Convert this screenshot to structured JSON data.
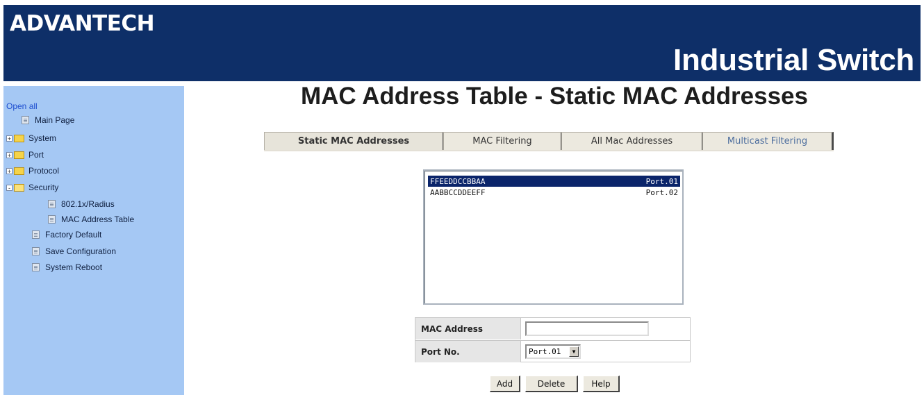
{
  "header": {
    "logo": "ADVANTECH",
    "product": "Industrial Switch"
  },
  "sidebar": {
    "open_all": "Open all",
    "items": [
      {
        "label": "Main Page",
        "type": "page"
      },
      {
        "label": "System",
        "type": "folder",
        "expand": "+"
      },
      {
        "label": "Port",
        "type": "folder",
        "expand": "+"
      },
      {
        "label": "Protocol",
        "type": "folder",
        "expand": "+"
      },
      {
        "label": "Security",
        "type": "folder",
        "expand": "-"
      },
      {
        "label": "802.1x/Radius",
        "type": "page"
      },
      {
        "label": "MAC Address Table",
        "type": "page"
      },
      {
        "label": "Factory Default",
        "type": "page"
      },
      {
        "label": "Save Configuration",
        "type": "page"
      },
      {
        "label": "System Reboot",
        "type": "page"
      }
    ]
  },
  "main": {
    "title": "MAC Address Table - Static MAC Addresses",
    "tabs": [
      {
        "label": "Static MAC Addresses",
        "active": true
      },
      {
        "label": "MAC Filtering",
        "active": false
      },
      {
        "label": "All Mac Addresses",
        "active": false
      },
      {
        "label": "Multicast Filtering",
        "active": false
      }
    ],
    "list": [
      {
        "mac": "FFEEDDCCBBAA",
        "port": "Port.01",
        "selected": true
      },
      {
        "mac": "AABBCCDDEEFF",
        "port": "Port.02",
        "selected": false
      }
    ],
    "form": {
      "mac_label": "MAC Address",
      "mac_value": "",
      "port_label": "Port No.",
      "port_value": "Port.01"
    },
    "buttons": {
      "add": "Add",
      "delete": "Delete",
      "help": "Help"
    }
  },
  "colors": {
    "header_bg": "#0e2f68",
    "sidebar_bg": "#a5c8f4",
    "selection_bg": "#0a246a"
  }
}
